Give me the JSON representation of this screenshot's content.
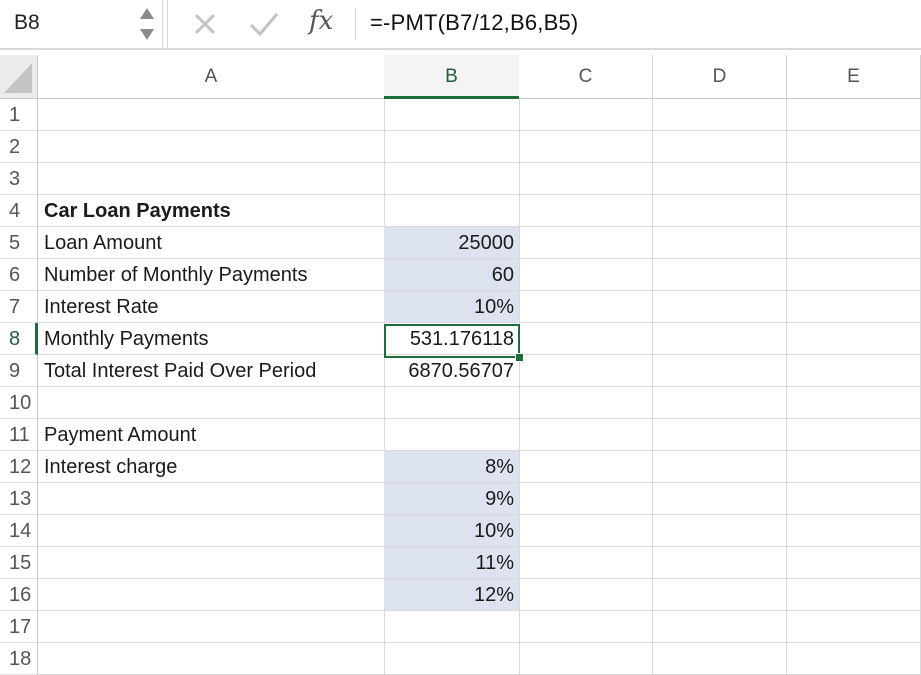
{
  "formula_bar": {
    "cell_ref": "B8",
    "formula": "=-PMT(B7/12,B6,B5)",
    "fx_label": "fx"
  },
  "columns": [
    "A",
    "B",
    "C",
    "D",
    "E"
  ],
  "active_column": "B",
  "active_row": "8",
  "rows": [
    {
      "num": "1",
      "a": "",
      "b": "",
      "b_shaded": false
    },
    {
      "num": "2",
      "a": "",
      "b": "",
      "b_shaded": false
    },
    {
      "num": "3",
      "a": "",
      "b": "",
      "b_shaded": false
    },
    {
      "num": "4",
      "a": "Car Loan Payments",
      "a_bold": true,
      "b": "",
      "b_shaded": false
    },
    {
      "num": "5",
      "a": "Loan Amount",
      "b": "25000",
      "b_shaded": true
    },
    {
      "num": "6",
      "a": "Number of Monthly Payments",
      "b": "60",
      "b_shaded": true
    },
    {
      "num": "7",
      "a": "Interest Rate",
      "b": "10%",
      "b_shaded": true
    },
    {
      "num": "8",
      "a": "Monthly Payments",
      "b": "531.176118",
      "b_shaded": false
    },
    {
      "num": "9",
      "a": "Total Interest Paid Over Period",
      "b": "6870.56707",
      "b_shaded": false
    },
    {
      "num": "10",
      "a": "",
      "b": "",
      "b_shaded": false
    },
    {
      "num": "11",
      "a": "Payment Amount",
      "b": "",
      "b_shaded": false
    },
    {
      "num": "12",
      "a": "Interest charge",
      "b": "8%",
      "b_shaded": true
    },
    {
      "num": "13",
      "a": "",
      "b": "9%",
      "b_shaded": true
    },
    {
      "num": "14",
      "a": "",
      "b": "10%",
      "b_shaded": true
    },
    {
      "num": "15",
      "a": "",
      "b": "11%",
      "b_shaded": true
    },
    {
      "num": "16",
      "a": "",
      "b": "12%",
      "b_shaded": true
    },
    {
      "num": "17",
      "a": "",
      "b": "",
      "b_shaded": false
    },
    {
      "num": "18",
      "a": "",
      "b": "",
      "b_shaded": false
    }
  ],
  "colors": {
    "accent": "#1e6b3b",
    "input_shading": "#dde2f0"
  }
}
